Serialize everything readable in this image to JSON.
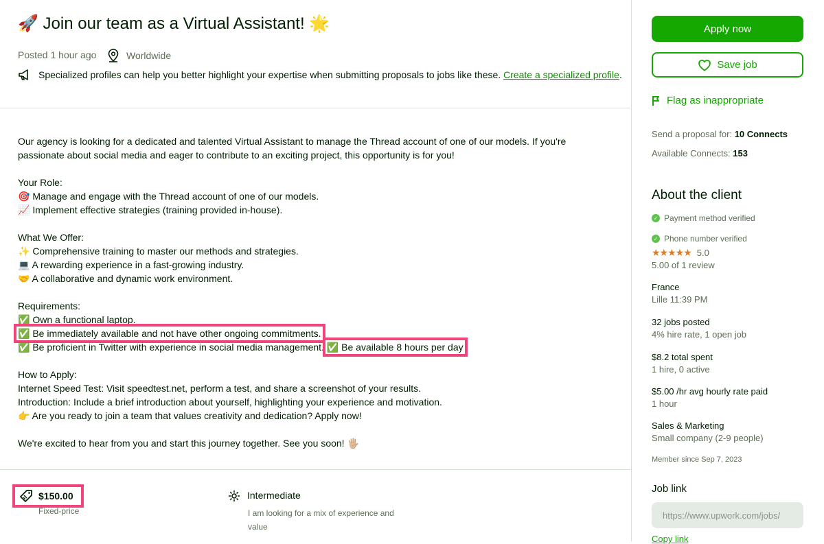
{
  "job": {
    "title": "🚀 Join our team as a Virtual Assistant! 🌟",
    "posted": "Posted 1 hour ago",
    "location": "Worldwide",
    "specialized_text": "Specialized profiles can help you better highlight your expertise when submitting proposals to jobs like these.",
    "specialized_link": "Create a specialized profile",
    "specialized_period": "."
  },
  "description": {
    "intro": "Our agency is looking for a dedicated and talented Virtual Assistant to manage the Thread account of one of our models. If you're passionate about social media and eager to contribute to an exciting project, this opportunity is for you!",
    "role_heading": "Your Role:",
    "role_items": [
      "🎯 Manage and engage with the Thread account of one of our models.",
      "📈 Implement effective strategies (training provided in-house)."
    ],
    "offer_heading": "What We Offer:",
    "offer_items": [
      "✨ Comprehensive training to master our methods and strategies.",
      "💻 A rewarding experience in a fast-growing industry.",
      "🤝 A collaborative and dynamic work environment."
    ],
    "req_heading": "Requirements:",
    "req_1": "✅ Own a functional laptop.",
    "req_2": "✅ Be immediately available and not have other ongoing commitments.",
    "req_3": "✅ Be proficient in Twitter with experience in social media management.",
    "req_4": "✅ Be available 8 hours per day",
    "apply_heading": "How to Apply:",
    "apply_items": [
      "Internet Speed Test: Visit speedtest.net, perform a test, and share a screenshot of your results.",
      "Introduction: Include a brief introduction about yourself, highlighting your experience and motivation.",
      "👉 Are you ready to join a team that values creativity and dedication? Apply now!"
    ],
    "closing": "We're excited to hear from you and start this journey together. See you soon! 🖐🏼"
  },
  "budget": {
    "amount": "$150.00",
    "type": "Fixed-price",
    "level": "Intermediate",
    "level_desc": "I am looking for a mix of experience and value"
  },
  "sidebar": {
    "apply_label": "Apply now",
    "save_label": "Save job",
    "flag_label": "Flag as inappropriate",
    "send_prefix": "Send a proposal for: ",
    "send_value": "10 Connects",
    "avail_prefix": "Available Connects: ",
    "avail_value": "153"
  },
  "client": {
    "heading": "About the client",
    "payment": "Payment method verified",
    "phone": "Phone number verified",
    "rating": "5.0",
    "reviews": "5.00 of 1 review",
    "country": "France",
    "city_time": "Lille 11:39 PM",
    "jobs_posted": "32 jobs posted",
    "hire_rate": "4% hire rate, 1 open job",
    "total_spent": "$8.2 total spent",
    "hires": "1 hire, 0 active",
    "avg_rate": "$5.00 /hr avg hourly rate paid",
    "hours": "1 hour",
    "industry": "Sales & Marketing",
    "company_size": "Small company (2-9 people)",
    "member_since": "Member since Sep 7, 2023"
  },
  "job_link": {
    "heading": "Job link",
    "url": "https://www.upwork.com/jobs/",
    "copy_label": "Copy link"
  },
  "colors": {
    "accent": "#14a800",
    "highlight": "#f0457a",
    "star": "#e07a1f"
  }
}
